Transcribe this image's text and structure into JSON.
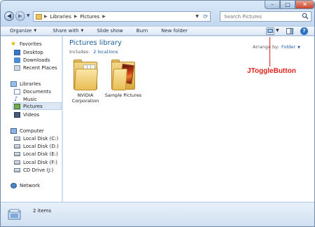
{
  "address": {
    "crumbs": [
      "Libraries",
      "Pictures"
    ]
  },
  "search": {
    "placeholder": "Search Pictures"
  },
  "toolbar": {
    "organize": "Organize",
    "share_with": "Share with",
    "slide_show": "Slide show",
    "burn": "Burn",
    "new_folder": "New folder"
  },
  "nav": {
    "favorites": "Favorites",
    "desktop": "Desktop",
    "downloads": "Downloads",
    "recent_places": "Recent Places",
    "libraries": "Libraries",
    "documents": "Documents",
    "music": "Music",
    "pictures": "Pictures",
    "videos": "Videos",
    "computer": "Computer",
    "disk_c": "Local Disk (C:)",
    "disk_d": "Local Disk (D:)",
    "disk_e": "Local Disk (E:)",
    "disk_f": "Local Disk (F:)",
    "cd_drive": "CD Drive (J:)",
    "network": "Network"
  },
  "library": {
    "title": "Pictures library",
    "includes_label": "Includes:",
    "includes_link": "2 locations",
    "arrange_label": "Arrange by:",
    "arrange_value": "Folder"
  },
  "folders": [
    {
      "name_line1": "NVIDIA",
      "name_line2": "Corporation"
    },
    {
      "name_line1": "Sample Pictures",
      "name_line2": ""
    }
  ],
  "annotation": {
    "text": "JToggleButton",
    "color": "#e0201b"
  },
  "details": {
    "item_count": "2 items"
  },
  "colors": {
    "accent": "#1e5e9b",
    "link": "#1f5fa8",
    "selection": "#dbe7f5"
  }
}
